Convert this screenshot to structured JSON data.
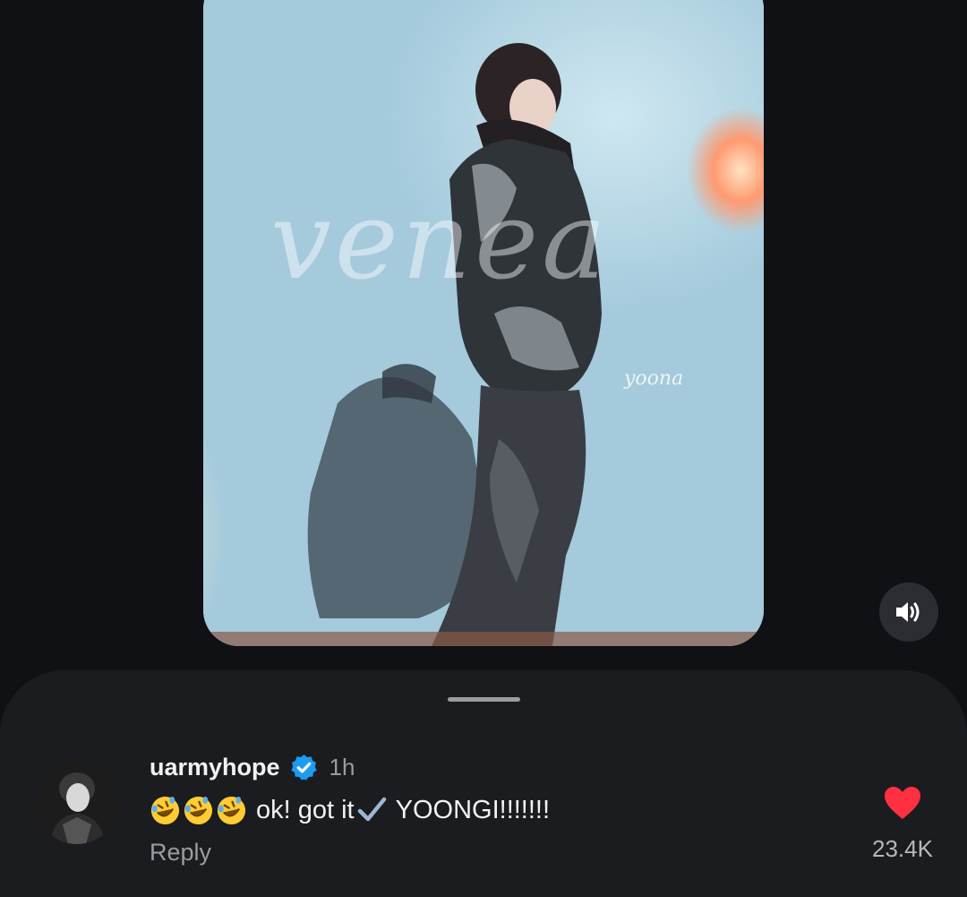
{
  "video": {
    "watermark_main": "venea",
    "watermark_sub": "yoona",
    "sound_icon": "speaker-on-icon"
  },
  "comment": {
    "username": "uarmyhope",
    "verified_icon": "verified-badge-icon",
    "time": "1h",
    "text_after_emojis": "ok! got it",
    "text_end": "YOONGI!!!!!!!",
    "emoji_icon": "rolling-on-floor-laughing-emoji",
    "emoji_count": 3,
    "check_icon": "check-mark-icon",
    "reply_label": "Reply",
    "like_icon": "heart-icon",
    "like_count": "23.4K"
  },
  "colors": {
    "background": "#0f1115",
    "sheet": "#1a1c20",
    "verified_blue": "#1d9bf0",
    "heart_red": "#ff3040",
    "muted_text": "#9a9ca0"
  }
}
